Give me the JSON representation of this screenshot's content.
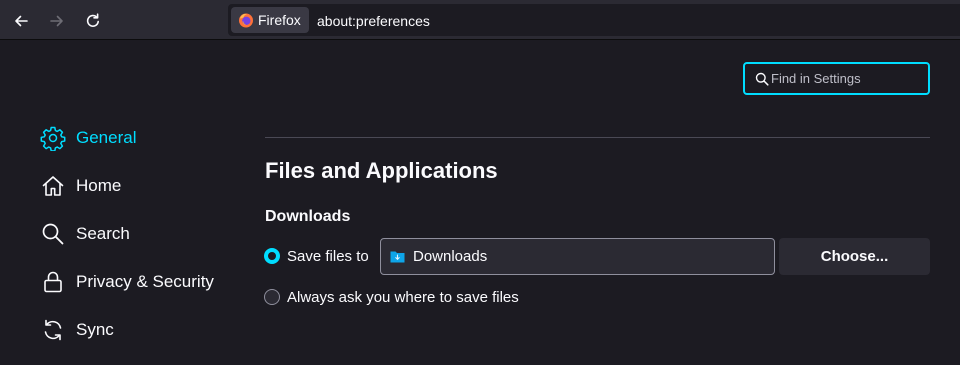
{
  "toolbar": {
    "identity_label": "Firefox",
    "url": "about:preferences"
  },
  "search": {
    "placeholder": "Find in Settings"
  },
  "sidebar": {
    "items": [
      {
        "label": "General",
        "icon": "gear-icon",
        "selected": true
      },
      {
        "label": "Home",
        "icon": "home-icon",
        "selected": false
      },
      {
        "label": "Search",
        "icon": "search-icon",
        "selected": false
      },
      {
        "label": "Privacy & Security",
        "icon": "lock-icon",
        "selected": false
      },
      {
        "label": "Sync",
        "icon": "sync-icon",
        "selected": false
      }
    ]
  },
  "main": {
    "section_title": "Files and Applications",
    "downloads": {
      "title": "Downloads",
      "save_label": "Save files to",
      "folder": "Downloads",
      "choose_label": "Choose...",
      "ask_label": "Always ask you where to save files",
      "selected_option": "save"
    }
  },
  "colors": {
    "accent": "#00ddff",
    "background": "#1c1b22",
    "toolbar": "#2b2a33",
    "text": "#fbfbfe"
  }
}
